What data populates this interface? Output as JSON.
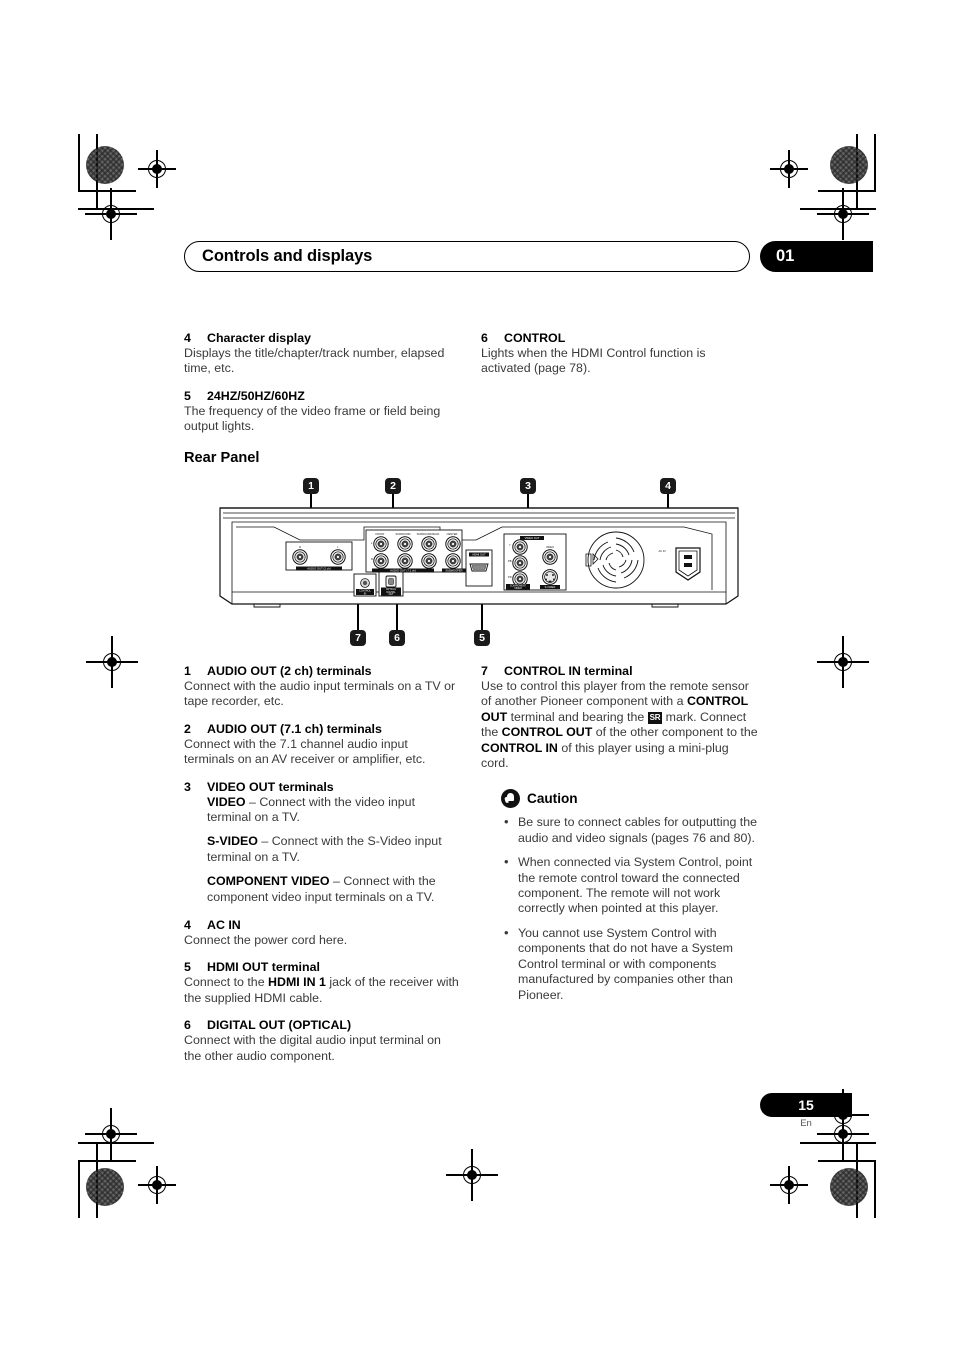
{
  "header": {
    "title": "Controls and displays",
    "chapter_number": "01"
  },
  "top_items": [
    {
      "num": "4",
      "title": "Character display",
      "body": "Displays the title/chapter/track number, elapsed time, etc."
    },
    {
      "num": "5",
      "title": "24HZ/50HZ/60HZ",
      "body": "The frequency of the video frame or field being output lights."
    },
    {
      "num": "6",
      "title": "CONTROL",
      "body": "Lights when the HDMI Control function is activated (page 78)."
    }
  ],
  "section": {
    "title": "Rear Panel"
  },
  "figure": {
    "callouts_top": [
      "1",
      "2",
      "3",
      "4"
    ],
    "callouts_bottom": [
      "7",
      "6",
      "5"
    ],
    "panel_labels": {
      "audio_2ch": "AUDIO OUT (2 ch)",
      "audio_2ch_r": "R",
      "audio_2ch_l": "L",
      "audio_71ch": "AUDIO OUT (7.1 ch)",
      "front": "FRONT",
      "surround": "SURROUND",
      "surround_back": "SURROUND BACK",
      "center": "CENTER",
      "subwoofer": "SUBWOOFER",
      "row_l": "L",
      "row_r": "R",
      "control_in": "CONTROL IN",
      "optical": "OPTICAL",
      "digital_out": "DIGITAL OUT",
      "hdmi_out": "HDMI OUT",
      "video_out": "VIDEO OUT",
      "component_video": "COMPONENT VIDEO",
      "comp_y": "Y",
      "comp_pb": "PB",
      "comp_pr": "PR",
      "video": "VIDEO",
      "s_video": "S-VIDEO",
      "ac_in": "AC IN"
    }
  },
  "left_items": [
    {
      "num": "1",
      "title": "AUDIO OUT (2 ch) terminals",
      "body": "Connect with the audio input terminals on a TV or tape recorder, etc."
    },
    {
      "num": "2",
      "title": "AUDIO OUT (7.1 ch) terminals",
      "body": "Connect with the 7.1 channel audio input terminals on an AV receiver or amplifier, etc."
    },
    {
      "num": "3",
      "title": "VIDEO OUT terminals",
      "sub": [
        {
          "key": "VIDEO",
          "text": " – Connect with the video input terminal on a TV."
        },
        {
          "key": "S-VIDEO",
          "text": " – Connect with the S-Video input terminal on a TV."
        },
        {
          "key": "COMPONENT VIDEO",
          "text": " – Connect with the component video input terminals on a TV."
        }
      ]
    },
    {
      "num": "4",
      "title": "AC IN",
      "body": "Connect the power cord here."
    },
    {
      "num": "5",
      "title": "HDMI OUT terminal",
      "body_parts": {
        "pre": "Connect to the ",
        "key": "HDMI IN 1",
        "post": " jack of the receiver with the supplied HDMI cable."
      }
    },
    {
      "num": "6",
      "title": "DIGITAL OUT (OPTICAL)",
      "body": "Connect with the digital audio input terminal on the other audio component."
    }
  ],
  "right_item": {
    "num": "7",
    "title": "CONTROL IN terminal",
    "parts": {
      "p1": "Use to control this player from the remote sensor of another Pioneer component with a ",
      "k1": "CONTROL OUT",
      "p2": " terminal and bearing the ",
      "mark": "SR",
      "p3": " mark. Connect the ",
      "k2": "CONTROL OUT",
      "p4": " of the other component to the ",
      "k3": "CONTROL IN",
      "p5": " of this player using a mini-plug cord."
    }
  },
  "caution": {
    "label": "Caution",
    "icon": "hand-icon",
    "bullets": [
      "Be sure to connect cables for outputting the audio and video signals (pages 76 and 80).",
      "When connected via System Control, point the remote control toward the connected component. The remote will not work correctly when pointed at this player.",
      "You cannot use System Control with components that do not have a System Control terminal or with components manufactured by companies other than Pioneer."
    ]
  },
  "footer": {
    "page_number": "15",
    "language": "En"
  },
  "colors": {
    "ink": "#000000",
    "body_text": "#3a3a3a",
    "badge_bg": "#1a1a1a"
  }
}
